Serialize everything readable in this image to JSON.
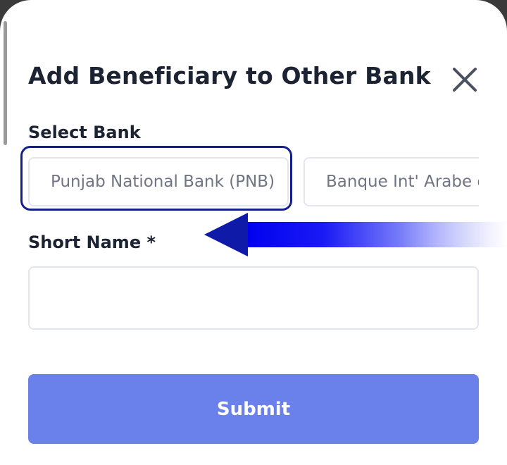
{
  "dialog": {
    "title": "Add Beneficiary to Other Bank",
    "close_icon": "close-icon"
  },
  "select_bank": {
    "label": "Select Bank",
    "options": [
      "Punjab National Bank (PNB)",
      "Banque Int' Arabe de Tunisie"
    ],
    "selected": "Punjab National Bank (PNB)"
  },
  "short_name": {
    "label": "Short Name *",
    "value": "",
    "placeholder": ""
  },
  "submit": {
    "label": "Submit"
  },
  "colors": {
    "accent": "#6a80eb",
    "focus_ring": "#141f8f",
    "arrow": "#0000ff",
    "text": "#1c2333"
  }
}
